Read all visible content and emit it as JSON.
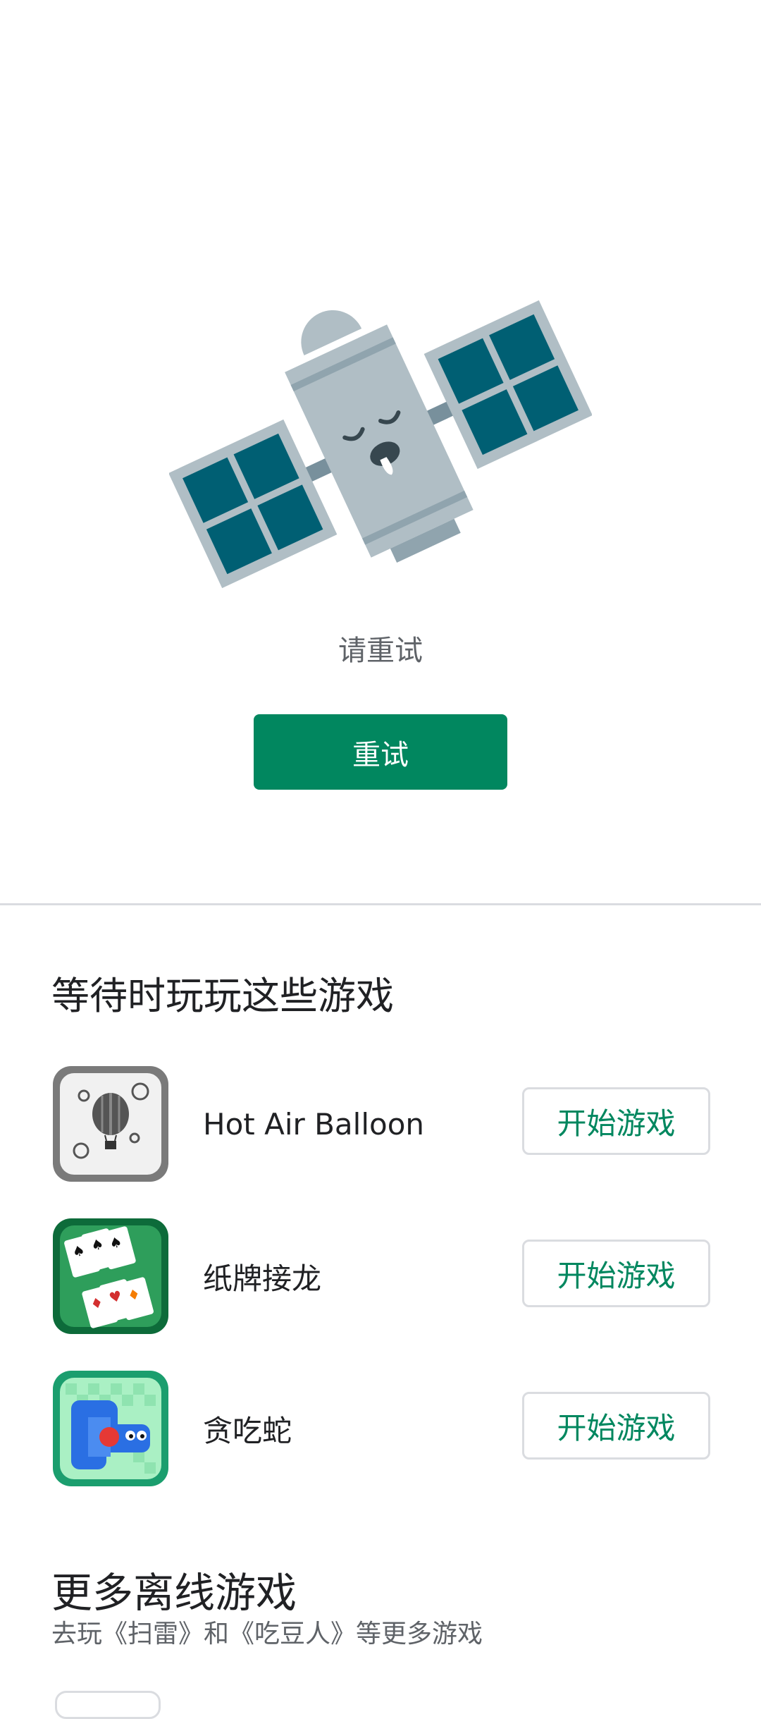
{
  "error": {
    "message": "请重试",
    "retry_label": "重试"
  },
  "games_section": {
    "title": "等待时玩玩这些游戏",
    "games": [
      {
        "name": "Hot Air Balloon",
        "play_label": "开始游戏",
        "icon": "hot-air-balloon-icon"
      },
      {
        "name": "纸牌接龙",
        "play_label": "开始游戏",
        "icon": "solitaire-icon"
      },
      {
        "name": "贪吃蛇",
        "play_label": "开始游戏",
        "icon": "snake-icon"
      }
    ]
  },
  "more_section": {
    "title": "更多离线游戏",
    "subtitle": "去玩《扫雷》和《吃豆人》等更多游戏"
  },
  "colors": {
    "accent": "#01875f",
    "satellite_panel": "#005f73",
    "satellite_body": "#b0bec5"
  }
}
